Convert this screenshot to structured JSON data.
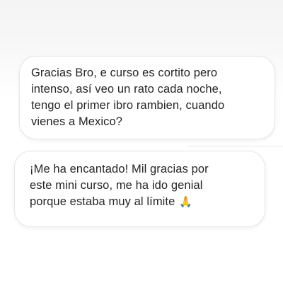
{
  "messages": [
    {
      "lines": [
        "Gracias Bro, e curso es cortito pero",
        "intenso, así veo un rato cada noche,",
        "tengo el primer ibro rambien, cuando",
        "vienes a Mexico?"
      ]
    },
    {
      "lines": [
        "¡Me ha encantado! Mil gracias por",
        "este mini curso, me ha ido genial",
        "porque estaba muy al límite"
      ],
      "emoji": "🙏",
      "emoji_name": "folded-hands-icon"
    }
  ]
}
